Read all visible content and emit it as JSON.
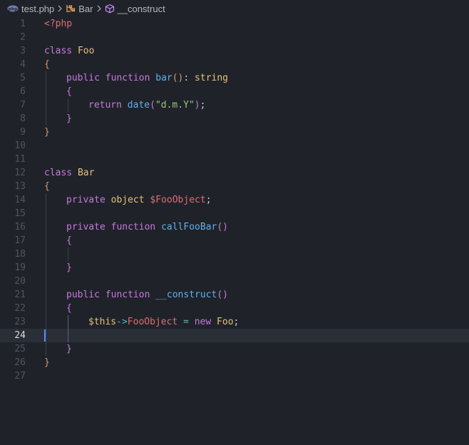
{
  "breadcrumb": {
    "file": "test.php",
    "class": "Bar",
    "method": "__construct",
    "file_icon": "php-elephant-icon",
    "class_icon": "class-symbol-icon",
    "method_icon": "method-cube-icon"
  },
  "colors": {
    "background": "#1f2329",
    "current_line": "#2a2f37",
    "keyword": "#c678dd",
    "class_name": "#e5c07b",
    "function": "#61afef",
    "string": "#98c379",
    "variable": "#e06c75"
  },
  "current_line": 24,
  "lines": [
    {
      "n": "1",
      "indent": 0,
      "tokens": [
        {
          "t": "<?php",
          "c": "tag"
        }
      ]
    },
    {
      "n": "2",
      "indent": 0,
      "tokens": []
    },
    {
      "n": "3",
      "indent": 0,
      "tokens": [
        {
          "t": "class ",
          "c": "kw"
        },
        {
          "t": "Foo",
          "c": "class"
        }
      ]
    },
    {
      "n": "4",
      "indent": 0,
      "tokens": [
        {
          "t": "{",
          "c": "brace"
        }
      ]
    },
    {
      "n": "5",
      "indent": 1,
      "tokens": [
        {
          "t": "public ",
          "c": "kw"
        },
        {
          "t": "function ",
          "c": "kw"
        },
        {
          "t": "bar",
          "c": "fn"
        },
        {
          "t": "()",
          "c": "brace"
        },
        {
          "t": ": ",
          "c": "plain"
        },
        {
          "t": "string",
          "c": "type"
        }
      ]
    },
    {
      "n": "6",
      "indent": 1,
      "tokens": [
        {
          "t": "{",
          "c": "brace2"
        }
      ]
    },
    {
      "n": "7",
      "indent": 2,
      "tokens": [
        {
          "t": "return ",
          "c": "kw"
        },
        {
          "t": "date",
          "c": "fn"
        },
        {
          "t": "(",
          "c": "paren"
        },
        {
          "t": "\"d.m.Y\"",
          "c": "str"
        },
        {
          "t": ")",
          "c": "paren"
        },
        {
          "t": ";",
          "c": "plain"
        }
      ]
    },
    {
      "n": "8",
      "indent": 1,
      "tokens": [
        {
          "t": "}",
          "c": "brace2"
        }
      ]
    },
    {
      "n": "9",
      "indent": 0,
      "tokens": [
        {
          "t": "}",
          "c": "brace"
        }
      ]
    },
    {
      "n": "10",
      "indent": 0,
      "tokens": []
    },
    {
      "n": "11",
      "indent": 0,
      "tokens": []
    },
    {
      "n": "12",
      "indent": 0,
      "tokens": [
        {
          "t": "class ",
          "c": "kw"
        },
        {
          "t": "Bar",
          "c": "class"
        }
      ]
    },
    {
      "n": "13",
      "indent": 0,
      "tokens": [
        {
          "t": "{",
          "c": "brace"
        }
      ]
    },
    {
      "n": "14",
      "indent": 1,
      "tokens": [
        {
          "t": "private ",
          "c": "kw"
        },
        {
          "t": "object ",
          "c": "type"
        },
        {
          "t": "$FooObject",
          "c": "var"
        },
        {
          "t": ";",
          "c": "plain"
        }
      ]
    },
    {
      "n": "15",
      "indent": 0,
      "tokens": []
    },
    {
      "n": "16",
      "indent": 1,
      "tokens": [
        {
          "t": "private ",
          "c": "kw"
        },
        {
          "t": "function ",
          "c": "kw"
        },
        {
          "t": "callFooBar",
          "c": "fn"
        },
        {
          "t": "()",
          "c": "paren"
        }
      ]
    },
    {
      "n": "17",
      "indent": 1,
      "tokens": [
        {
          "t": "{",
          "c": "brace2"
        }
      ]
    },
    {
      "n": "18",
      "indent": 0,
      "tokens": []
    },
    {
      "n": "19",
      "indent": 1,
      "tokens": [
        {
          "t": "}",
          "c": "brace2"
        }
      ]
    },
    {
      "n": "20",
      "indent": 0,
      "tokens": []
    },
    {
      "n": "21",
      "indent": 1,
      "tokens": [
        {
          "t": "public ",
          "c": "kw"
        },
        {
          "t": "function ",
          "c": "kw"
        },
        {
          "t": "__construct",
          "c": "fn"
        },
        {
          "t": "()",
          "c": "paren"
        }
      ]
    },
    {
      "n": "22",
      "indent": 1,
      "tokens": [
        {
          "t": "{",
          "c": "brace2"
        }
      ]
    },
    {
      "n": "23",
      "indent": 2,
      "tokens": [
        {
          "t": "$this",
          "c": "var2"
        },
        {
          "t": "->",
          "c": "op"
        },
        {
          "t": "FooObject",
          "c": "var"
        },
        {
          "t": " = ",
          "c": "op"
        },
        {
          "t": "new ",
          "c": "kw"
        },
        {
          "t": "Foo",
          "c": "class"
        },
        {
          "t": ";",
          "c": "plain"
        }
      ]
    },
    {
      "n": "24",
      "indent": 0,
      "tokens": []
    },
    {
      "n": "25",
      "indent": 1,
      "tokens": [
        {
          "t": "}",
          "c": "brace2"
        }
      ]
    },
    {
      "n": "26",
      "indent": 0,
      "tokens": [
        {
          "t": "}",
          "c": "brace"
        }
      ]
    },
    {
      "n": "27",
      "indent": 0,
      "tokens": []
    }
  ]
}
